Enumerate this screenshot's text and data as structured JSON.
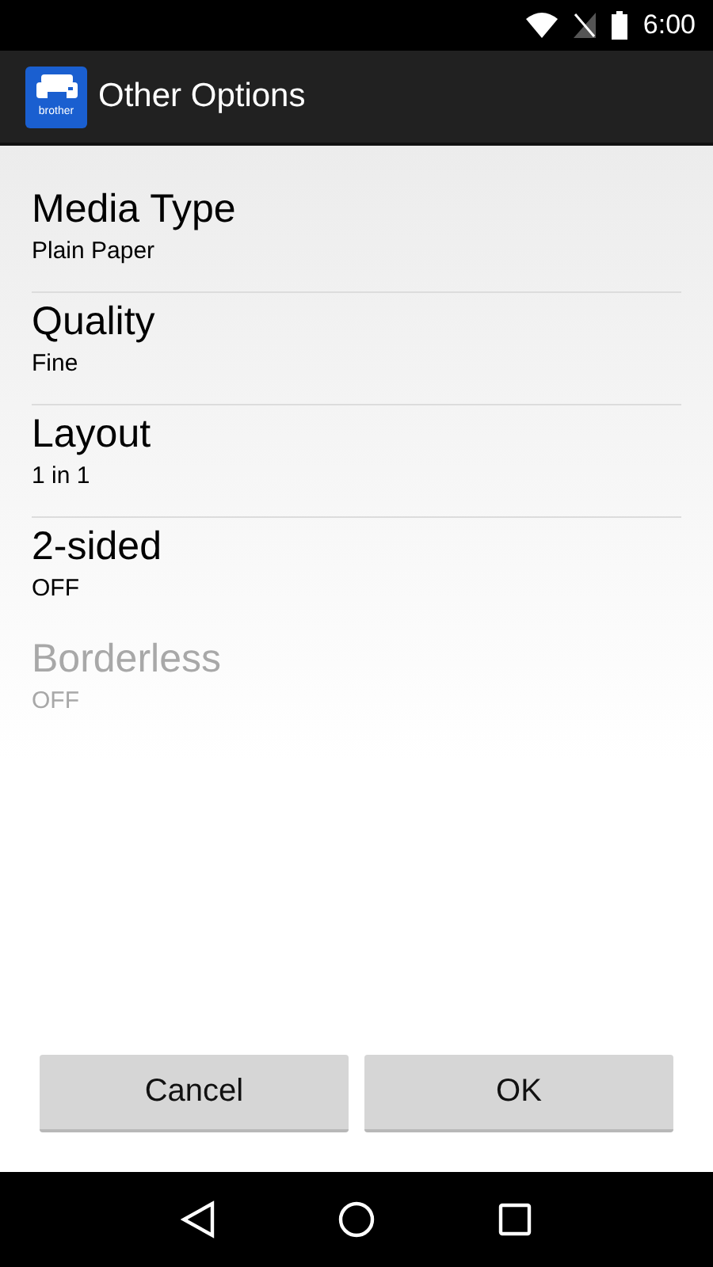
{
  "status_bar": {
    "time": "6:00"
  },
  "app_bar": {
    "logo_text": "brother",
    "title": "Other Options"
  },
  "options": [
    {
      "label": "Media Type",
      "value": "Plain Paper",
      "disabled": false,
      "divider": true
    },
    {
      "label": "Quality",
      "value": "Fine",
      "disabled": false,
      "divider": true
    },
    {
      "label": "Layout",
      "value": "1 in 1",
      "disabled": false,
      "divider": true
    },
    {
      "label": "2-sided",
      "value": "OFF",
      "disabled": false,
      "divider": false
    },
    {
      "label": "Borderless",
      "value": "OFF",
      "disabled": true,
      "divider": false
    }
  ],
  "buttons": [
    "Cancel",
    "OK"
  ]
}
